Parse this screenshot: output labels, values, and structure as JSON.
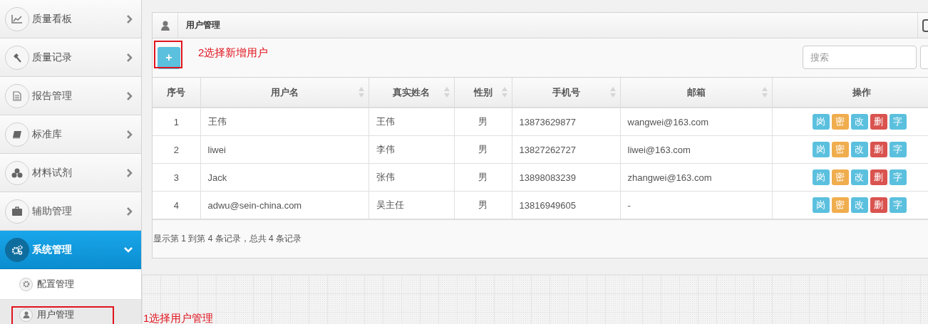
{
  "sidebar": {
    "items": [
      {
        "label": "质量看板",
        "selected": false,
        "expanded": false
      },
      {
        "label": "质量记录",
        "selected": false,
        "expanded": false
      },
      {
        "label": "报告管理",
        "selected": false,
        "expanded": false
      },
      {
        "label": "标准库",
        "selected": false,
        "expanded": false
      },
      {
        "label": "材料试剂",
        "selected": false,
        "expanded": false
      },
      {
        "label": "辅助管理",
        "selected": false,
        "expanded": false
      },
      {
        "label": "系统管理",
        "selected": true,
        "expanded": true,
        "children": [
          {
            "label": "配置管理",
            "selected": false
          },
          {
            "label": "用户管理",
            "selected": true,
            "annotation": "1选择用户管理"
          }
        ]
      }
    ]
  },
  "panel": {
    "title": "用户管理",
    "toolbar": {
      "add_button": {
        "label": "+",
        "annotation": "2选择新增用户"
      },
      "search": {
        "placeholder": "搜索"
      }
    },
    "table": {
      "columns": [
        {
          "label": "序号",
          "sortable": false
        },
        {
          "label": "用户名",
          "sortable": true
        },
        {
          "label": "真实姓名",
          "sortable": true
        },
        {
          "label": "性别",
          "sortable": true
        },
        {
          "label": "手机号",
          "sortable": true
        },
        {
          "label": "邮箱",
          "sortable": true
        },
        {
          "label": "操作",
          "sortable": false
        }
      ],
      "rows": [
        {
          "cells": [
            "1",
            "王伟",
            "王伟",
            "男",
            "13873629877",
            "wangwei@163.com"
          ],
          "actions": [
            {
              "label": "岗",
              "kind": "info"
            },
            {
              "label": "密",
              "kind": "warning"
            },
            {
              "label": "改",
              "kind": "info"
            },
            {
              "label": "删",
              "kind": "danger"
            },
            {
              "label": "字",
              "kind": "info"
            }
          ]
        },
        {
          "cells": [
            "2",
            "liwei",
            "李伟",
            "男",
            "13827262727",
            "liwei@163.com"
          ],
          "actions": [
            {
              "label": "岗",
              "kind": "info"
            },
            {
              "label": "密",
              "kind": "warning"
            },
            {
              "label": "改",
              "kind": "info"
            },
            {
              "label": "删",
              "kind": "danger"
            },
            {
              "label": "字",
              "kind": "info"
            }
          ]
        },
        {
          "cells": [
            "3",
            "Jack",
            "张伟",
            "男",
            "13898083239",
            "zhangwei@163.com"
          ],
          "actions": [
            {
              "label": "岗",
              "kind": "info"
            },
            {
              "label": "密",
              "kind": "warning"
            },
            {
              "label": "改",
              "kind": "info"
            },
            {
              "label": "删",
              "kind": "danger"
            },
            {
              "label": "字",
              "kind": "info"
            }
          ]
        },
        {
          "cells": [
            "4",
            "adwu@sein-china.com",
            "吴主任",
            "男",
            "13816949605",
            "-"
          ],
          "actions": [
            {
              "label": "岗",
              "kind": "info"
            },
            {
              "label": "密",
              "kind": "warning"
            },
            {
              "label": "改",
              "kind": "info"
            },
            {
              "label": "删",
              "kind": "danger"
            },
            {
              "label": "字",
              "kind": "info"
            }
          ]
        }
      ]
    },
    "footer": "显示第 1 到第 4 条记录，总共 4 条记录"
  }
}
